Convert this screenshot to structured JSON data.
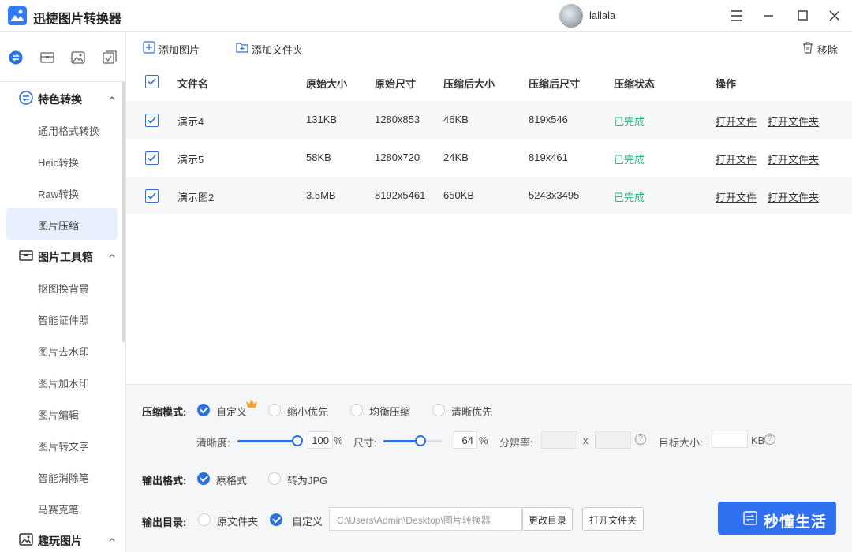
{
  "app": {
    "title": "迅捷图片转换器"
  },
  "user": {
    "name": "lallala"
  },
  "sidebar": {
    "groups": [
      {
        "label": "特色转换",
        "items": [
          "通用格式转换",
          "Heic转换",
          "Raw转换",
          "图片压缩"
        ]
      },
      {
        "label": "图片工具箱",
        "items": [
          "抠图换背景",
          "智能证件照",
          "图片去水印",
          "图片加水印",
          "图片编辑",
          "图片转文字",
          "智能消除笔",
          "马赛克笔"
        ]
      },
      {
        "label": "趣玩图片",
        "items": []
      }
    ],
    "active_item": "图片压缩"
  },
  "toolbar": {
    "add_image": "添加图片",
    "add_folder": "添加文件夹",
    "remove": "移除"
  },
  "table": {
    "headers": [
      "文件名",
      "原始大小",
      "原始尺寸",
      "压缩后大小",
      "压缩后尺寸",
      "压缩状态",
      "操作"
    ],
    "rows": [
      {
        "name": "演示4",
        "orig_size": "131KB",
        "orig_dim": "1280x853",
        "new_size": "46KB",
        "new_dim": "819x546",
        "status": "已完成",
        "open_file": "打开文件",
        "open_folder": "打开文件夹"
      },
      {
        "name": "演示5",
        "orig_size": "58KB",
        "orig_dim": "1280x720",
        "new_size": "24KB",
        "new_dim": "819x461",
        "status": "已完成",
        "open_file": "打开文件",
        "open_folder": "打开文件夹"
      },
      {
        "name": "演示图2",
        "orig_size": "3.5MB",
        "orig_dim": "8192x5461",
        "new_size": "650KB",
        "new_dim": "5243x3495",
        "status": "已完成",
        "open_file": "打开文件",
        "open_folder": "打开文件夹"
      }
    ]
  },
  "settings": {
    "mode": {
      "label": "压缩模式:",
      "options": [
        "自定义",
        "缩小优先",
        "均衡压缩",
        "清晰优先"
      ],
      "selected": "自定义"
    },
    "clarity": {
      "label": "清晰度:",
      "value": "100",
      "unit": "%",
      "fraction": 1.0
    },
    "size": {
      "label": "尺寸:",
      "value": "64",
      "unit": "%",
      "fraction": 0.64
    },
    "resolution": {
      "label": "分辨率:",
      "sep": "x"
    },
    "target": {
      "label": "目标大小:",
      "unit": "KB"
    },
    "format": {
      "label": "输出格式:",
      "options": [
        "原格式",
        "转为JPG"
      ],
      "selected": "原格式"
    },
    "output": {
      "label": "输出目录:",
      "options": [
        "原文件夹",
        "自定义"
      ],
      "selected": "自定义",
      "path": "C:\\Users\\Admin\\Desktop\\图片转换器",
      "change_btn": "更改目录",
      "open_btn": "打开文件夹"
    },
    "start_label": "秒懂生活"
  },
  "colors": {
    "accent": "#2f6ff0",
    "status_done": "#2fb27c",
    "active_bg": "#e8f0fd"
  }
}
